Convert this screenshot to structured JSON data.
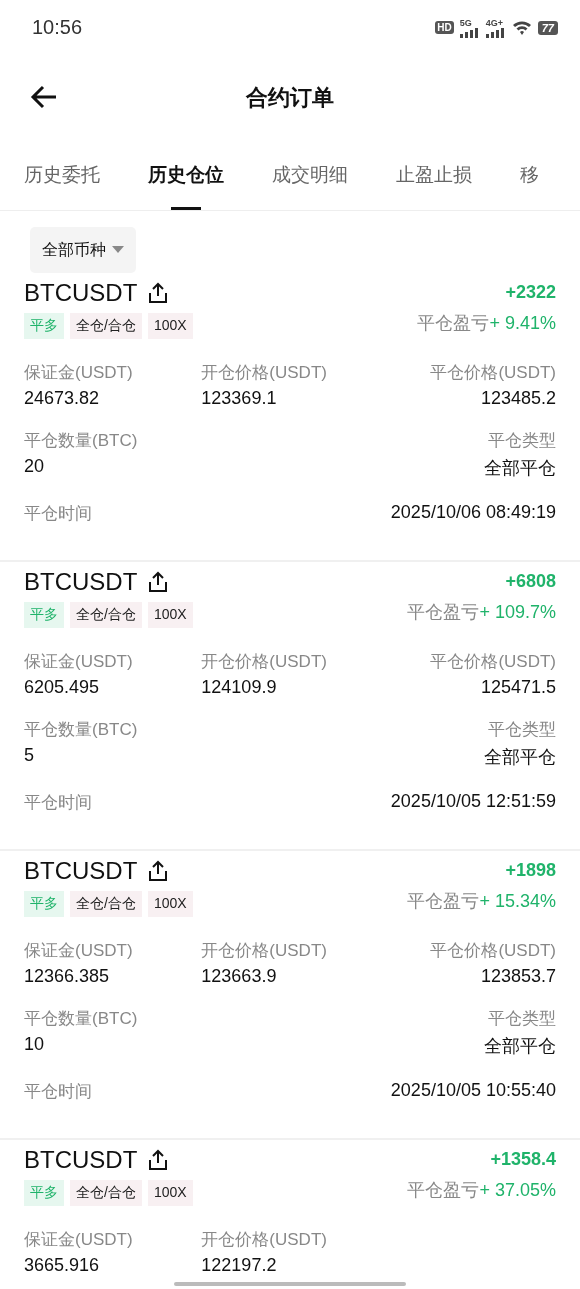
{
  "status_bar": {
    "time": "10:56",
    "hd": "HD",
    "sim_labels": [
      "5G",
      "4G+"
    ],
    "battery": "77"
  },
  "header": {
    "title": "合约订单"
  },
  "tabs": [
    {
      "label": "历史委托",
      "selected": false
    },
    {
      "label": "历史仓位",
      "selected": true
    },
    {
      "label": "成交明细",
      "selected": false
    },
    {
      "label": "止盈止损",
      "selected": false
    },
    {
      "label": "移",
      "selected": false
    }
  ],
  "filter": {
    "label": "全部币种"
  },
  "orders": [
    {
      "symbol": "BTCUSDT",
      "tags": [
        {
          "label": "平多",
          "kind": "side"
        },
        {
          "label": "全仓/合仓",
          "kind": "plain"
        },
        {
          "label": "100X",
          "kind": "plain"
        }
      ],
      "pnl": "+2322",
      "pnl_label": "平仓盈亏",
      "pnl_pct": "+ 9.41%",
      "row_1": [
        {
          "label": "保证金(USDT)",
          "value": "24673.82"
        },
        {
          "label": "开仓价格(USDT)",
          "value": "123369.1"
        },
        {
          "label": "平仓价格(USDT)",
          "value": "123485.2"
        }
      ],
      "quantity": {
        "label": "平仓数量(BTC)",
        "value": "20"
      },
      "close_type": {
        "label": "平仓类型",
        "value": "全部平仓"
      },
      "close_time": {
        "label": "平仓时间",
        "value": "2025/10/06 08:49:19"
      }
    },
    {
      "symbol": "BTCUSDT",
      "tags": [
        {
          "label": "平多",
          "kind": "side"
        },
        {
          "label": "全仓/合仓",
          "kind": "plain"
        },
        {
          "label": "100X",
          "kind": "plain"
        }
      ],
      "pnl": "+6808",
      "pnl_label": "平仓盈亏",
      "pnl_pct": "+ 109.7%",
      "row_1": [
        {
          "label": "保证金(USDT)",
          "value": "6205.495"
        },
        {
          "label": "开仓价格(USDT)",
          "value": "124109.9"
        },
        {
          "label": "平仓价格(USDT)",
          "value": "125471.5"
        }
      ],
      "quantity": {
        "label": "平仓数量(BTC)",
        "value": "5"
      },
      "close_type": {
        "label": "平仓类型",
        "value": "全部平仓"
      },
      "close_time": {
        "label": "平仓时间",
        "value": "2025/10/05 12:51:59"
      }
    },
    {
      "symbol": "BTCUSDT",
      "tags": [
        {
          "label": "平多",
          "kind": "side"
        },
        {
          "label": "全仓/合仓",
          "kind": "plain"
        },
        {
          "label": "100X",
          "kind": "plain"
        }
      ],
      "pnl": "+1898",
      "pnl_label": "平仓盈亏",
      "pnl_pct": "+ 15.34%",
      "row_1": [
        {
          "label": "保证金(USDT)",
          "value": "12366.385"
        },
        {
          "label": "开仓价格(USDT)",
          "value": "123663.9"
        },
        {
          "label": "平仓价格(USDT)",
          "value": "123853.7"
        }
      ],
      "quantity": {
        "label": "平仓数量(BTC)",
        "value": "10"
      },
      "close_type": {
        "label": "平仓类型",
        "value": "全部平仓"
      },
      "close_time": {
        "label": "平仓时间",
        "value": "2025/10/05 10:55:40"
      }
    },
    {
      "symbol": "BTCUSDT",
      "tags": [
        {
          "label": "平多",
          "kind": "side"
        },
        {
          "label": "全仓/合仓",
          "kind": "plain"
        },
        {
          "label": "100X",
          "kind": "plain"
        }
      ],
      "pnl": "+1358.4",
      "pnl_label": "平仓盈亏",
      "pnl_pct": "+ 37.05%",
      "row_1": [
        {
          "label": "保证金(USDT)",
          "value": "3665.916"
        },
        {
          "label": "开仓价格(USDT)",
          "value": "122197.2"
        }
      ]
    }
  ]
}
